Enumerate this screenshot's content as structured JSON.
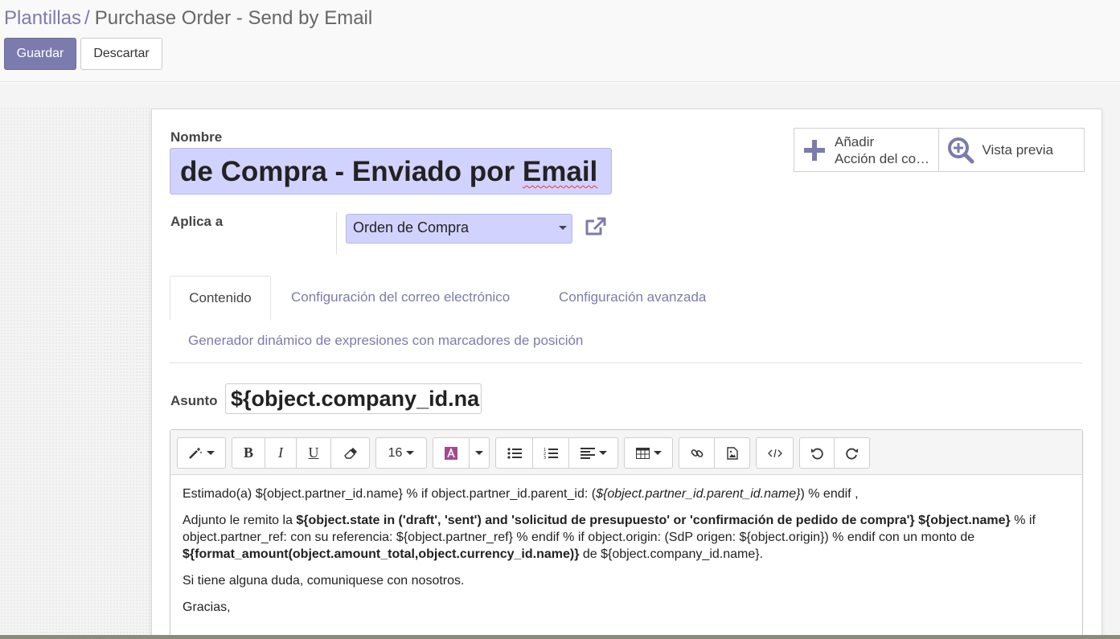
{
  "breadcrumb": {
    "parent": "Plantillas",
    "separator": "/",
    "current": "Purchase Order - Send by Email"
  },
  "buttons": {
    "save": "Guardar",
    "discard": "Descartar"
  },
  "form": {
    "name_label": "Nombre",
    "name_value_part1": "de Compra - Enviado por ",
    "name_value_part2": "Email",
    "applies_label": "Aplica a",
    "model_value": "Orden de Compra",
    "subject_label": "Asunto",
    "subject_value": "${object.company_id.name} Orden de Compra (Ref ${object.name or 'n/a' })"
  },
  "smart_buttons": {
    "add_action_line1": "Añadir",
    "add_action_line2": "Acción del co…",
    "preview": "Vista previa"
  },
  "tabs": [
    {
      "label": "Contenido",
      "active": true
    },
    {
      "label": "Configuración del correo electrónico",
      "active": false
    },
    {
      "label": "Configuración avanzada",
      "active": false
    },
    {
      "label": "Generador dinámico de expresiones con marcadores de posición",
      "active": false
    }
  ],
  "toolbar": {
    "font_size": "16"
  },
  "body": {
    "p1": "Estimado(a) ${object.partner_id.name} % if object.partner_id.parent_id: (",
    "p1_italic": "${object.partner_id.parent_id.name}",
    "p1_end": ") % endif ,",
    "p2_a": "Adjunto le remito la ",
    "p2_b": "${object.state in ('draft', 'sent') and 'solicitud de presupuesto' or 'confirmación de pedido de compra'} ${object.name}",
    "p2_c": " % if object.partner_ref: con su referencia: ${object.partner_ref} % endif % if object.origin: (SdP origen: ${object.origin}) % endif con un monto de ",
    "p2_d": "${format_amount(object.amount_total,object.currency_id.name)}",
    "p2_e": " de ${object.company_id.name}.",
    "p3": "Si tiene alguna duda, comuniquese con nosotros.",
    "p4": "Gracias,"
  },
  "colors": {
    "brand": "#7c7bad",
    "required_field_bg": "#d2d2ff",
    "link": "#7c7bad"
  }
}
